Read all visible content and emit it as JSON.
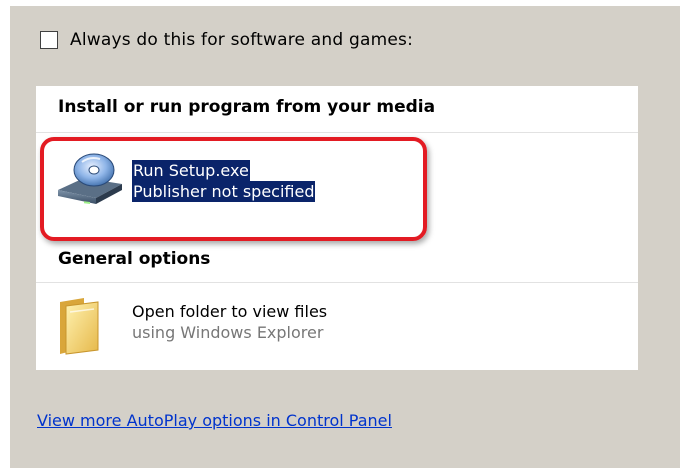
{
  "always": {
    "label": "Always do this for software and games:",
    "checked": false
  },
  "sections": [
    {
      "header": "Install or run program from your media",
      "options": [
        {
          "icon": "cd-drive-icon",
          "line1": "Run Setup.exe",
          "line2": "Publisher not specified",
          "selected": true
        }
      ]
    },
    {
      "header": "General options",
      "options": [
        {
          "icon": "folder-icon",
          "line1": "Open folder to view files",
          "line2": "using Windows Explorer",
          "selected": false
        }
      ]
    }
  ],
  "footer_link": "View more AutoPlay options in Control Panel",
  "colors": {
    "dialog_bg": "#d4d0c8",
    "selection_bg": "#0a246a",
    "highlight_ring": "#e31b23",
    "link": "#0033cc"
  }
}
